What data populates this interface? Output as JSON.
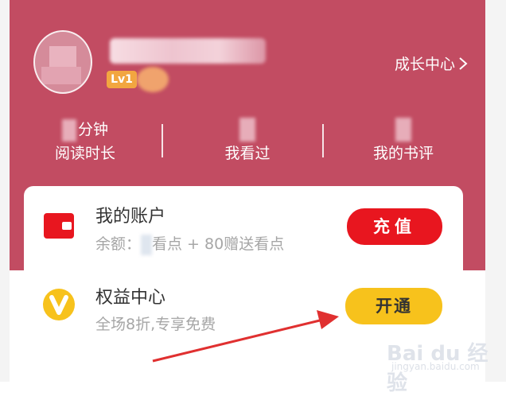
{
  "profile": {
    "level": "Lv1"
  },
  "growth_center": {
    "label": "成长中心"
  },
  "stats": [
    {
      "value_suffix": "分钟",
      "label": "阅读时长"
    },
    {
      "value_suffix": "",
      "label": "我看过"
    },
    {
      "value_suffix": "",
      "label": "我的书评"
    }
  ],
  "account": {
    "title": "我的账户",
    "balance_prefix": "余额：",
    "balance_suffix": "看点 + 80赠送看点",
    "button": "充值"
  },
  "rights": {
    "title": "权益中心",
    "subtitle": "全场8折,专享免费",
    "button": "开通"
  },
  "watermark": {
    "logo": "Bai du 经验",
    "url": "jingyan.baidu.com"
  },
  "colors": {
    "header_bg": "#c24c62",
    "recharge_button": "#e8161f",
    "open_button": "#f7c21c",
    "level_badge": "#f2a640",
    "arrow": "#e03030"
  }
}
